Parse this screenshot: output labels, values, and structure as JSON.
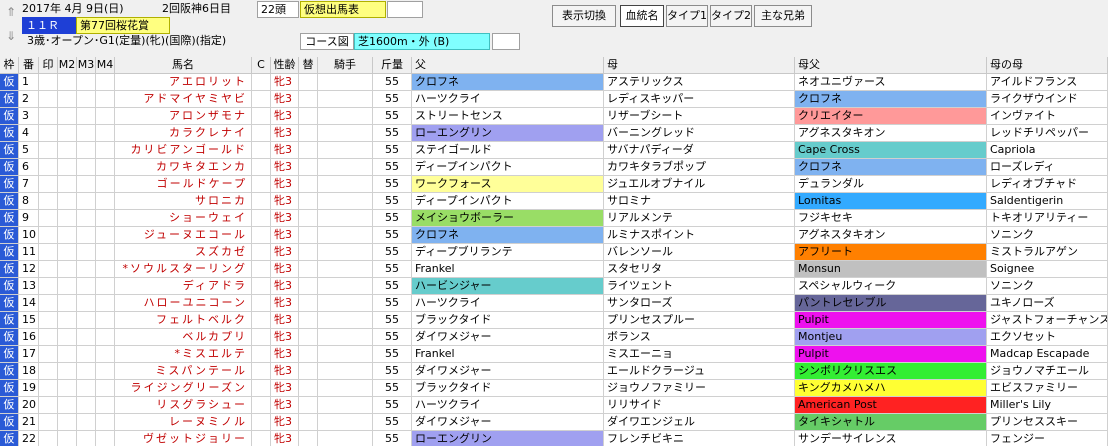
{
  "race": {
    "date": "2017年 4月 9日(日)",
    "meeting": "2回阪神6日目",
    "heads": "22頭",
    "card_type": "仮想出馬表",
    "race_no": "１１Ｒ",
    "race_name": "第77回桜花賞",
    "conditions": "3歳･オープン･G1(定量)(牝)(国際)(指定)",
    "course_label": "コース図",
    "course": "芝1600m・外 (B)"
  },
  "toolbar": {
    "display_switch": "表示切換",
    "buttons": [
      "血統名",
      "タイプ1",
      "タイプ2",
      "主な兄弟"
    ],
    "active_index": 0
  },
  "nav": {
    "up": "⇑",
    "down": "⇓"
  },
  "columns": {
    "waku": "枠",
    "num": "番",
    "mark": "印",
    "m2": "M2",
    "m3": "M3",
    "m4": "M4",
    "name": "馬名",
    "c": "C",
    "sex_age": "性齢",
    "change": "替",
    "jockey": "騎手",
    "weight": "斤量",
    "sire": "父",
    "dam": "母",
    "damsire": "母父",
    "damdam": "母の母"
  },
  "colors": {
    "yellow": "#ffff99",
    "blue": "#7fb2f0",
    "purple": "#a0a0f0",
    "pink": "#ff9999",
    "cyan": "#66cccc",
    "green": "#99dd66",
    "orange": "#ff8000",
    "gray": "#c0c0c0",
    "slate": "#666699",
    "magenta": "#ee11ee",
    "lime": "#33ee33",
    "brightyellow": "#ffff33",
    "red": "#ff2222",
    "lightblue": "#33ccff",
    "skyblue": "#33aaff",
    "medgreen": "#66cc66"
  },
  "horses": [
    {
      "waku": "仮",
      "num": "1",
      "name": "アエロリット",
      "sex": "牝3",
      "wt": "55",
      "sire": "クロフネ",
      "sire_c": "blue",
      "dam": "アステリックス",
      "dam_c": "",
      "ds": "ネオユニヴァース",
      "ds_c": "",
      "dd": "アイルドフランス",
      "dd_c": ""
    },
    {
      "waku": "仮",
      "num": "2",
      "name": "アドマイヤミヤビ",
      "sex": "牝3",
      "wt": "55",
      "sire": "ハーツクライ",
      "sire_c": "",
      "dam": "レディスキッパー",
      "dam_c": "",
      "ds": "クロフネ",
      "ds_c": "blue",
      "dd": "ライクザウインド",
      "dd_c": ""
    },
    {
      "waku": "仮",
      "num": "3",
      "name": "アロンザモナ",
      "sex": "牝3",
      "wt": "55",
      "sire": "ストリートセンス",
      "sire_c": "",
      "dam": "リザーブシート",
      "dam_c": "",
      "ds": "クリエイター",
      "ds_c": "pink",
      "dd": "インヴァイト",
      "dd_c": ""
    },
    {
      "waku": "仮",
      "num": "4",
      "name": "カラクレナイ",
      "sex": "牝3",
      "wt": "55",
      "sire": "ローエングリン",
      "sire_c": "purple",
      "dam": "バーニングレッド",
      "dam_c": "",
      "ds": "アグネスタキオン",
      "ds_c": "",
      "dd": "レッドチリペッパー",
      "dd_c": ""
    },
    {
      "waku": "仮",
      "num": "5",
      "name": "カリビアンゴールド",
      "sex": "牝3",
      "wt": "55",
      "sire": "ステイゴールド",
      "sire_c": "",
      "dam": "サバナパディーダ",
      "dam_c": "",
      "ds": "Cape Cross",
      "ds_c": "cyan",
      "dd": "Capriola",
      "dd_c": ""
    },
    {
      "waku": "仮",
      "num": "6",
      "name": "カワキタエンカ",
      "sex": "牝3",
      "wt": "55",
      "sire": "ディープインパクト",
      "sire_c": "",
      "dam": "カワキタラブポップ",
      "dam_c": "",
      "ds": "クロフネ",
      "ds_c": "blue",
      "dd": "ローズレディ",
      "dd_c": ""
    },
    {
      "waku": "仮",
      "num": "7",
      "name": "ゴールドケープ",
      "sex": "牝3",
      "wt": "55",
      "sire": "ワークフォース",
      "sire_c": "yellow",
      "dam": "ジュエルオブナイル",
      "dam_c": "",
      "ds": "デュランダル",
      "ds_c": "",
      "dd": "レディオブチャド",
      "dd_c": ""
    },
    {
      "waku": "仮",
      "num": "8",
      "name": "サロニカ",
      "sex": "牝3",
      "wt": "55",
      "sire": "ディープインパクト",
      "sire_c": "",
      "dam": "サロミナ",
      "dam_c": "",
      "ds": "Lomitas",
      "ds_c": "skyblue",
      "dd": "Saldentigerin",
      "dd_c": ""
    },
    {
      "waku": "仮",
      "num": "9",
      "name": "ショーウェイ",
      "sex": "牝3",
      "wt": "55",
      "sire": "メイショウボーラー",
      "sire_c": "green",
      "dam": "リアルメンテ",
      "dam_c": "",
      "ds": "フジキセキ",
      "ds_c": "",
      "dd": "トキオリアリティー",
      "dd_c": ""
    },
    {
      "waku": "仮",
      "num": "10",
      "name": "ジューヌエコール",
      "sex": "牝3",
      "wt": "55",
      "sire": "クロフネ",
      "sire_c": "blue",
      "dam": "ルミナスポイント",
      "dam_c": "",
      "ds": "アグネスタキオン",
      "ds_c": "",
      "dd": "ソニンク",
      "dd_c": ""
    },
    {
      "waku": "仮",
      "num": "11",
      "name": "スズカゼ",
      "sex": "牝3",
      "wt": "55",
      "sire": "ディープブリランテ",
      "sire_c": "",
      "dam": "バレンソール",
      "dam_c": "",
      "ds": "アフリート",
      "ds_c": "orange",
      "dd": "ミストラルアゲン",
      "dd_c": ""
    },
    {
      "waku": "仮",
      "num": "12",
      "name": "*ソウルスターリング",
      "sex": "牝3",
      "wt": "55",
      "sire": "Frankel",
      "sire_c": "",
      "dam": "スタセリタ",
      "dam_c": "",
      "ds": "Monsun",
      "ds_c": "gray",
      "dd": "Soignee",
      "dd_c": ""
    },
    {
      "waku": "仮",
      "num": "13",
      "name": "ディアドラ",
      "sex": "牝3",
      "wt": "55",
      "sire": "ハービンジャー",
      "sire_c": "cyan",
      "dam": "ライツェント",
      "dam_c": "",
      "ds": "スペシャルウィーク",
      "ds_c": "",
      "dd": "ソニンク",
      "dd_c": ""
    },
    {
      "waku": "仮",
      "num": "14",
      "name": "ハローユニコーン",
      "sex": "牝3",
      "wt": "55",
      "sire": "ハーツクライ",
      "sire_c": "",
      "dam": "サンタローズ",
      "dam_c": "",
      "ds": "パントレセレブル",
      "ds_c": "slate",
      "dd": "ユキノローズ",
      "dd_c": ""
    },
    {
      "waku": "仮",
      "num": "15",
      "name": "フェルトベルク",
      "sex": "牝3",
      "wt": "55",
      "sire": "ブラックタイド",
      "sire_c": "",
      "dam": "プリンセスプルー",
      "dam_c": "",
      "ds": "Pulpit",
      "ds_c": "magenta",
      "dd": "ジャストフォーチャンス",
      "dd_c": ""
    },
    {
      "waku": "仮",
      "num": "16",
      "name": "ベルカプリ",
      "sex": "牝3",
      "wt": "55",
      "sire": "ダイワメジャー",
      "sire_c": "",
      "dam": "ボランス",
      "dam_c": "",
      "ds": "Montjeu",
      "ds_c": "purple",
      "dd": "エクソセット",
      "dd_c": ""
    },
    {
      "waku": "仮",
      "num": "17",
      "name": "*ミスエルテ",
      "sex": "牝3",
      "wt": "55",
      "sire": "Frankel",
      "sire_c": "",
      "dam": "ミスエーニョ",
      "dam_c": "",
      "ds": "Pulpit",
      "ds_c": "magenta",
      "dd": "Madcap Escapade",
      "dd_c": ""
    },
    {
      "waku": "仮",
      "num": "18",
      "name": "ミスパンテール",
      "sex": "牝3",
      "wt": "55",
      "sire": "ダイワメジャー",
      "sire_c": "",
      "dam": "エールドクラージュ",
      "dam_c": "",
      "ds": "シンボリクリスエス",
      "ds_c": "lime",
      "dd": "ジョウノマチエール",
      "dd_c": ""
    },
    {
      "waku": "仮",
      "num": "19",
      "name": "ライジングリーズン",
      "sex": "牝3",
      "wt": "55",
      "sire": "ブラックタイド",
      "sire_c": "",
      "dam": "ジョウノファミリー",
      "dam_c": "",
      "ds": "キングカメハメハ",
      "ds_c": "brightyellow",
      "dd": "エビスファミリー",
      "dd_c": ""
    },
    {
      "waku": "仮",
      "num": "20",
      "name": "リスグラシュー",
      "sex": "牝3",
      "wt": "55",
      "sire": "ハーツクライ",
      "sire_c": "",
      "dam": "リリサイド",
      "dam_c": "",
      "ds": "American Post",
      "ds_c": "red",
      "dd": "Miller's Lily",
      "dd_c": ""
    },
    {
      "waku": "仮",
      "num": "21",
      "name": "レーヌミノル",
      "sex": "牝3",
      "wt": "55",
      "sire": "ダイワメジャー",
      "sire_c": "",
      "dam": "ダイワエンジェル",
      "dam_c": "",
      "ds": "タイキシャトル",
      "ds_c": "medgreen",
      "dd": "プリンセススキー",
      "dd_c": ""
    },
    {
      "waku": "仮",
      "num": "22",
      "name": "ヴゼットジョリー",
      "sex": "牝3",
      "wt": "55",
      "sire": "ローエングリン",
      "sire_c": "purple",
      "dam": "フレンチビキニ",
      "dam_c": "",
      "ds": "サンデーサイレンス",
      "ds_c": "",
      "dd": "フェンジー",
      "dd_c": ""
    }
  ]
}
